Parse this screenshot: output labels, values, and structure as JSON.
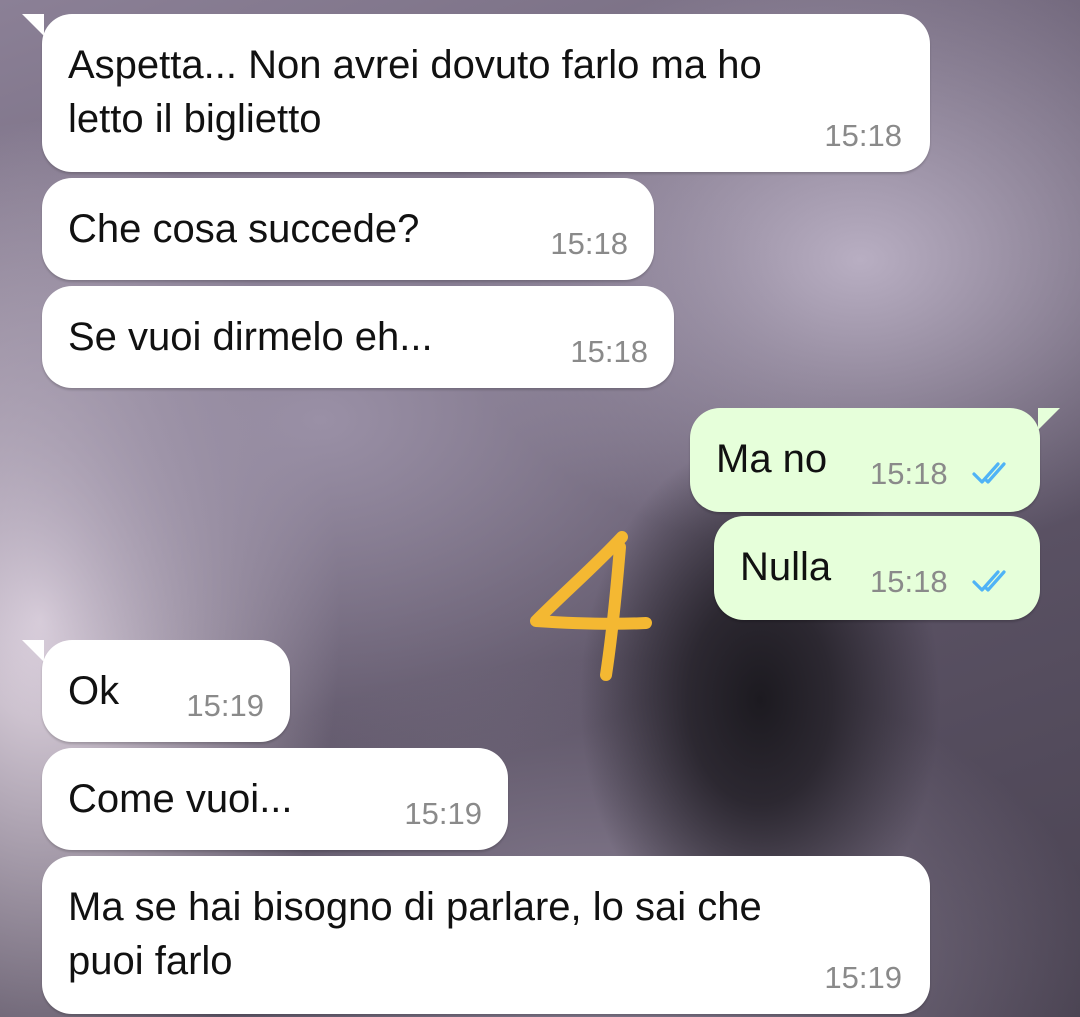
{
  "messages": [
    {
      "direction": "incoming",
      "text": "Aspetta... Non avrei dovuto farlo ma ho\nletto il biglietto",
      "time": "15:18"
    },
    {
      "direction": "incoming",
      "text": "Che cosa succede?",
      "time": "15:18"
    },
    {
      "direction": "incoming",
      "text": "Se vuoi dirmelo eh...",
      "time": "15:18"
    },
    {
      "direction": "outgoing",
      "text": "Ma no",
      "time": "15:18",
      "status": "read"
    },
    {
      "direction": "outgoing",
      "text": "Nulla",
      "time": "15:18",
      "status": "read"
    },
    {
      "direction": "incoming",
      "text": "Ok",
      "time": "15:19"
    },
    {
      "direction": "incoming",
      "text": "Come vuoi...",
      "time": "15:19"
    },
    {
      "direction": "incoming",
      "text": "Ma se hai bisogno di parlare, lo sai che\npuoi farlo",
      "time": "15:19"
    }
  ],
  "annotation": {
    "text": "4",
    "color": "#f4b832"
  },
  "colors": {
    "incoming_bubble": "#ffffff",
    "outgoing_bubble": "#e6ffda",
    "read_ticks": "#4fb3f6",
    "timestamp": "#8a8a8a"
  },
  "icons": {
    "read_status": "double-check-icon"
  }
}
